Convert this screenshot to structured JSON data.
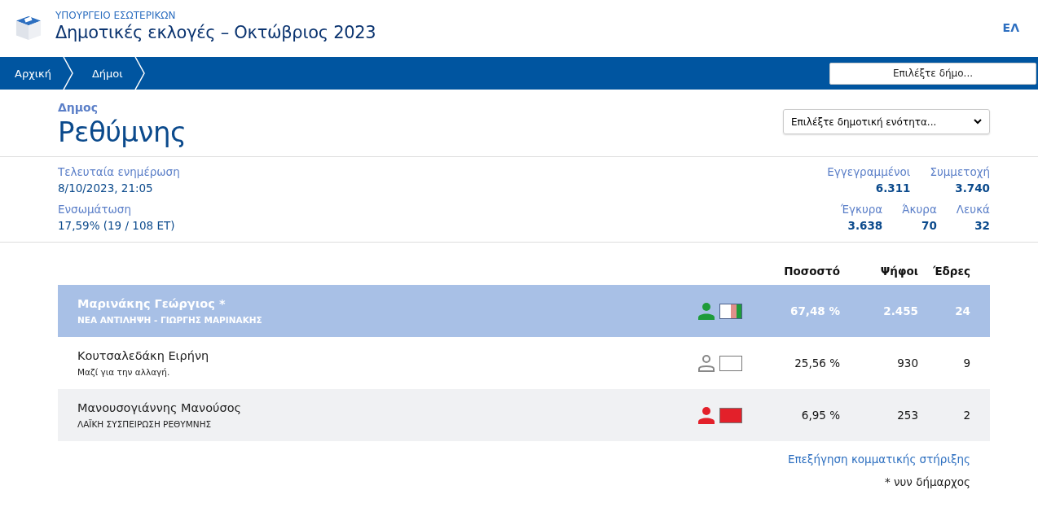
{
  "header": {
    "ministry": "ΥΠΟΥΡΓΕΙΟ ΕΣΩΤΕΡΙΚΩΝ",
    "title": "Δημοτικές εκλογές – Οκτώβριος 2023",
    "language": "ΕΛ"
  },
  "breadcrumbs": [
    "Αρχική",
    "Δήμοι"
  ],
  "municipality_picker": {
    "label": "Επιλέξτε δήμο..."
  },
  "municipality": {
    "caption": "Δημος",
    "name": "Ρεθύμνης"
  },
  "unit_select": {
    "value": "Επιλέξτε δημοτική ενότητα..."
  },
  "update": {
    "label": "Τελευταία ενημέρωση",
    "value": "8/10/2023, 21:05"
  },
  "incorporation": {
    "label": "Ενσωμάτωση",
    "value": "17,59% (19 / 108 ΕΤ)"
  },
  "stats_top": [
    {
      "label": "Εγγεγραμμένοι",
      "value": "6.311"
    },
    {
      "label": "Συμμετοχή",
      "value": "3.740"
    }
  ],
  "stats_bottom": [
    {
      "label": "Έγκυρα",
      "value": "3.638"
    },
    {
      "label": "Άκυρα",
      "value": "70"
    },
    {
      "label": "Λευκά",
      "value": "32"
    }
  ],
  "columns": [
    "Ποσοστό",
    "Ψήφοι",
    "Έδρες"
  ],
  "candidates": [
    {
      "name": "Μαρινάκης Γεώργιος *",
      "party": "ΝΕΑ ΑΝΤΙΛΗΨΗ - ΓΙΩΡΓΗΣ ΜΑΡΙΝΑΚΗΣ",
      "selected": true,
      "color": "#1e9b3a",
      "flag": [
        {
          "color": "#ffffff"
        },
        {
          "color": "#e0908a"
        },
        {
          "color": "#1e9b3a"
        }
      ],
      "percent": "67,48 %",
      "votes": "2.455",
      "seats": "24"
    },
    {
      "name": "Κουτσαλεδάκη Ειρήνη",
      "party": "Μαζί για την αλλαγή.",
      "selected": false,
      "color": "#888888",
      "flag": [
        {
          "color": "#ffffff"
        }
      ],
      "percent": "25,56 %",
      "votes": "930",
      "seats": "9"
    },
    {
      "name": "Μανουσογιάννης Μανούσος",
      "party": "ΛΑΪΚΗ ΣΥΣΠΕΙΡΩΣΗ ΡΕΘΥΜΝΗΣ",
      "selected": false,
      "color": "#e3202a",
      "flag": [
        {
          "color": "#e3202a"
        }
      ],
      "percent": "6,95 %",
      "votes": "253",
      "seats": "2"
    }
  ],
  "support_link": "Επεξήγηση κομματικής στήριξης",
  "footnote": "* νυν δήμαρχος"
}
